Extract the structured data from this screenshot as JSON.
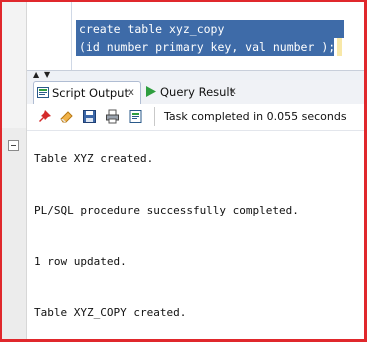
{
  "editor": {
    "lines": [
      "create table xyz_copy",
      "(id number primary key, val number );"
    ]
  },
  "tabs": [
    {
      "label": "Script Output",
      "close": "x",
      "icon": "script-output-icon"
    },
    {
      "label": "Query Result",
      "close": "x",
      "icon": "run-arrow-icon"
    }
  ],
  "toolbar": {
    "buttons": [
      "pin-icon",
      "eraser-icon",
      "save-icon",
      "print-icon",
      "log-icon"
    ],
    "status": "Task completed in 0.055 seconds"
  },
  "output": {
    "lines": [
      "Table XYZ created.",
      "PL/SQL procedure successfully completed.",
      "1 row updated.",
      "Table XYZ_COPY created."
    ]
  },
  "colors": {
    "frame": "#e0282c",
    "selection": "#3e6ba8",
    "run_icon": "#2e9e3e"
  }
}
